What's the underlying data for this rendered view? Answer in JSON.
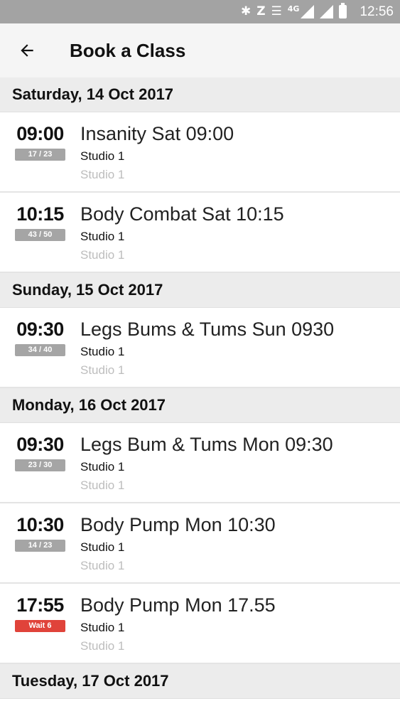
{
  "status_bar": {
    "time": "12:56",
    "network": "4G",
    "icons": [
      "bluetooth-icon",
      "nfc-icon",
      "vibrate-icon",
      "mobile-signal-icon",
      "wifi-signal-icon",
      "battery-icon"
    ]
  },
  "app_bar": {
    "title": "Book a Class",
    "back_icon": "arrow-left-icon"
  },
  "days": [
    {
      "label": "Saturday, 14 Oct 2017",
      "classes": [
        {
          "time": "09:00",
          "badge": "17 / 23",
          "badge_type": "capacity",
          "name": "Insanity Sat 09:00",
          "location": "Studio 1",
          "sublocation": "Studio 1"
        },
        {
          "time": "10:15",
          "badge": "43 / 50",
          "badge_type": "capacity",
          "name": "Body Combat Sat 10:15",
          "location": "Studio 1",
          "sublocation": "Studio 1"
        }
      ]
    },
    {
      "label": "Sunday, 15 Oct 2017",
      "classes": [
        {
          "time": "09:30",
          "badge": "34 / 40",
          "badge_type": "capacity",
          "name": "Legs Bums & Tums Sun 0930",
          "location": "Studio 1",
          "sublocation": "Studio 1"
        }
      ]
    },
    {
      "label": "Monday, 16 Oct 2017",
      "classes": [
        {
          "time": "09:30",
          "badge": "23 / 30",
          "badge_type": "capacity",
          "name": "Legs Bum & Tums Mon 09:30",
          "location": "Studio 1",
          "sublocation": "Studio 1"
        },
        {
          "time": "10:30",
          "badge": "14 / 23",
          "badge_type": "capacity",
          "name": "Body Pump Mon 10:30",
          "location": "Studio 1",
          "sublocation": "Studio 1"
        },
        {
          "time": "17:55",
          "badge": "Wait 6",
          "badge_type": "waitlist",
          "name": "Body Pump Mon 17.55",
          "location": "Studio 1",
          "sublocation": "Studio 1"
        }
      ]
    },
    {
      "label": "Tuesday, 17 Oct 2017",
      "classes": []
    }
  ],
  "colors": {
    "status_bar": "#a3a3a3",
    "app_bar": "#f5f5f5",
    "day_header": "#ececec",
    "capacity_badge": "#a5a5a5",
    "waitlist_badge": "#e0433a"
  }
}
